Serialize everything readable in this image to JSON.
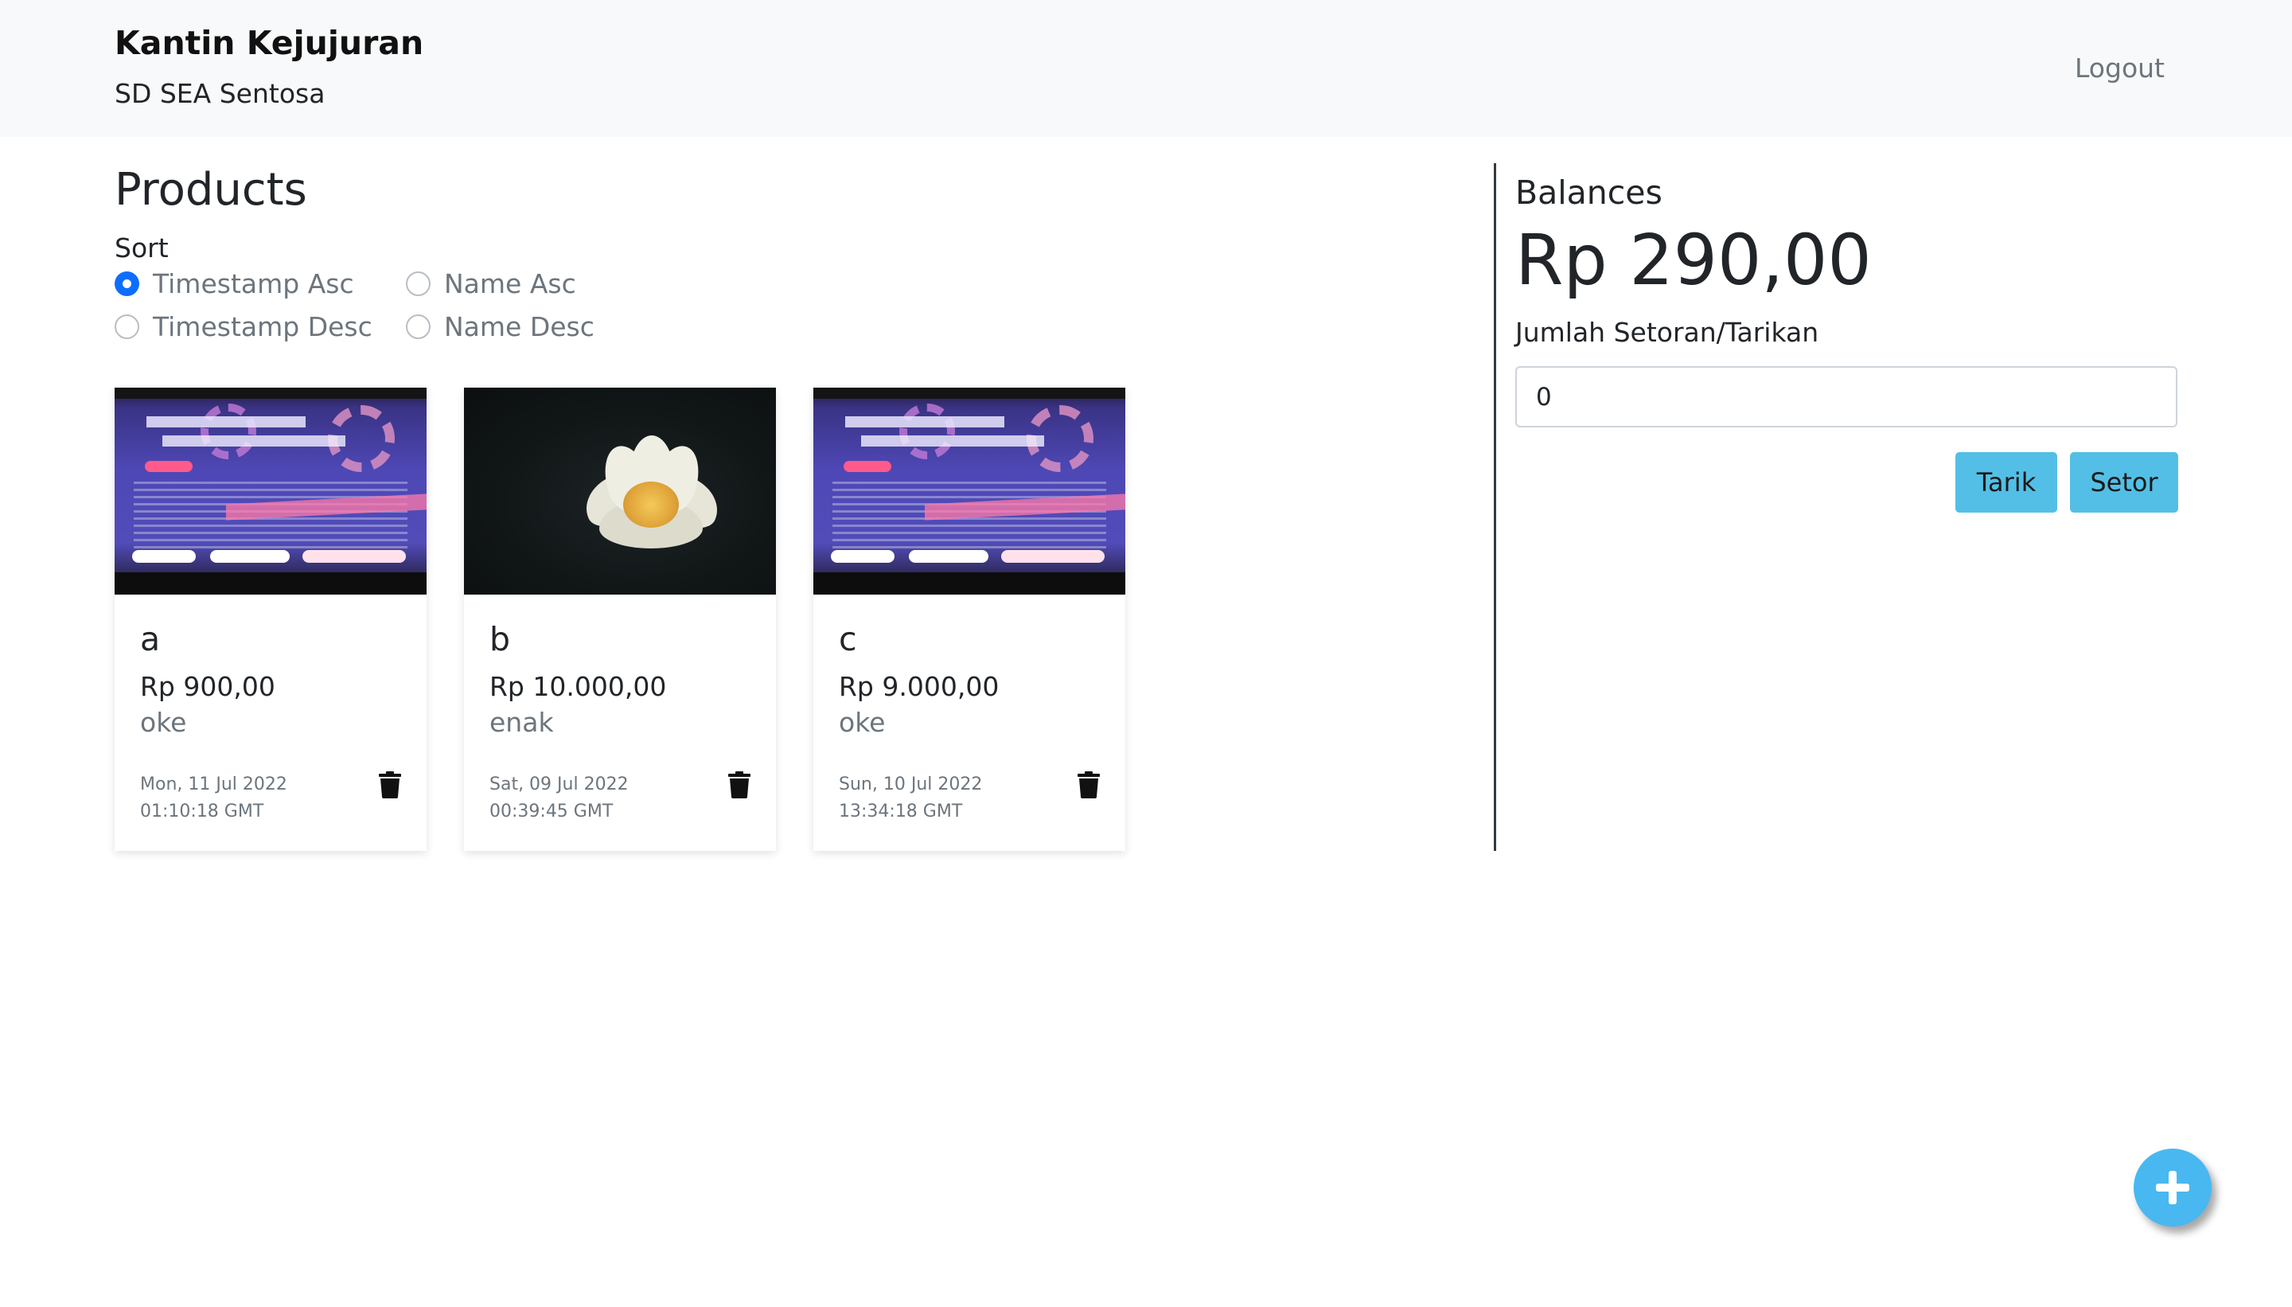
{
  "navbar": {
    "title": "Kantin Kejujuran",
    "subtitle": "SD SEA Sentosa",
    "logout_label": "Logout"
  },
  "products": {
    "title": "Products",
    "sort_label": "Sort",
    "sort_options": [
      {
        "label": "Timestamp Asc",
        "checked": true
      },
      {
        "label": "Name Asc",
        "checked": false
      },
      {
        "label": "Timestamp Desc",
        "checked": false
      },
      {
        "label": "Name Desc",
        "checked": false
      }
    ],
    "items": [
      {
        "name": "a",
        "price": "Rp 900,00",
        "description": "oke",
        "timestamp": "Mon, 11 Jul 2022 01:10:18 GMT",
        "image": "event-poster-image"
      },
      {
        "name": "b",
        "price": "Rp 10.000,00",
        "description": "enak",
        "timestamp": "Sat, 09 Jul 2022 00:39:45 GMT",
        "image": "lotus-flower-image"
      },
      {
        "name": "c",
        "price": "Rp 9.000,00",
        "description": "oke",
        "timestamp": "Sun, 10 Jul 2022 13:34:18 GMT",
        "image": "event-poster-image"
      }
    ]
  },
  "balance": {
    "title": "Balances",
    "value": "Rp 290,00",
    "amount_label": "Jumlah Setoran/Tarikan",
    "amount_value": "0",
    "withdraw_label": "Tarik",
    "deposit_label": "Setor"
  },
  "icons": {
    "delete": "trash-icon",
    "add": "plus-icon"
  },
  "colors": {
    "navbar_bg": "#f8f9fa",
    "radio_checked": "#0d6efd",
    "button_info": "#53bfe6",
    "fab": "#49b8f0"
  }
}
